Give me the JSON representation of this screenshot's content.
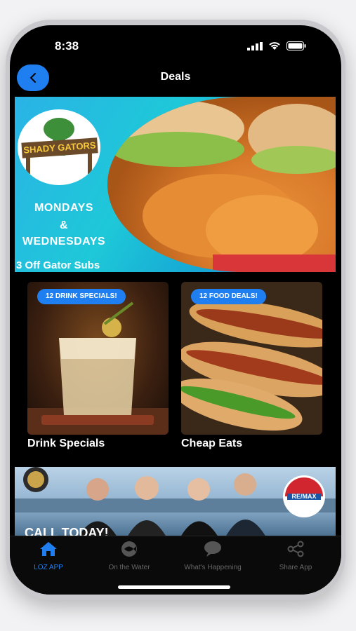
{
  "status": {
    "time": "8:38"
  },
  "nav": {
    "title": "Deals",
    "back_icon": "chevron-left-icon"
  },
  "banner": {
    "logo_text": "SHADY GATORS",
    "line1": "MONDAYS",
    "line2": "&",
    "line3": "WEDNESDAYS",
    "offer": "3 Off Gator Subs"
  },
  "cards": [
    {
      "badge": "12 DRINK SPECIALS!",
      "label": "Drink Specials"
    },
    {
      "badge": "12 FOOD DEALS!",
      "label": "Cheap Eats"
    }
  ],
  "ad": {
    "call_text": "CALL TODAY!",
    "brand": "RE/MAX"
  },
  "tabs": [
    {
      "label": "LOZ APP",
      "icon": "home-icon",
      "active": true
    },
    {
      "label": "On the Water",
      "icon": "fish-icon",
      "active": false
    },
    {
      "label": "What's Happening",
      "icon": "chat-bubble-icon",
      "active": false
    },
    {
      "label": "Share App",
      "icon": "share-icon",
      "active": false
    }
  ],
  "colors": {
    "accent": "#1f7ff0",
    "background": "#000000"
  }
}
